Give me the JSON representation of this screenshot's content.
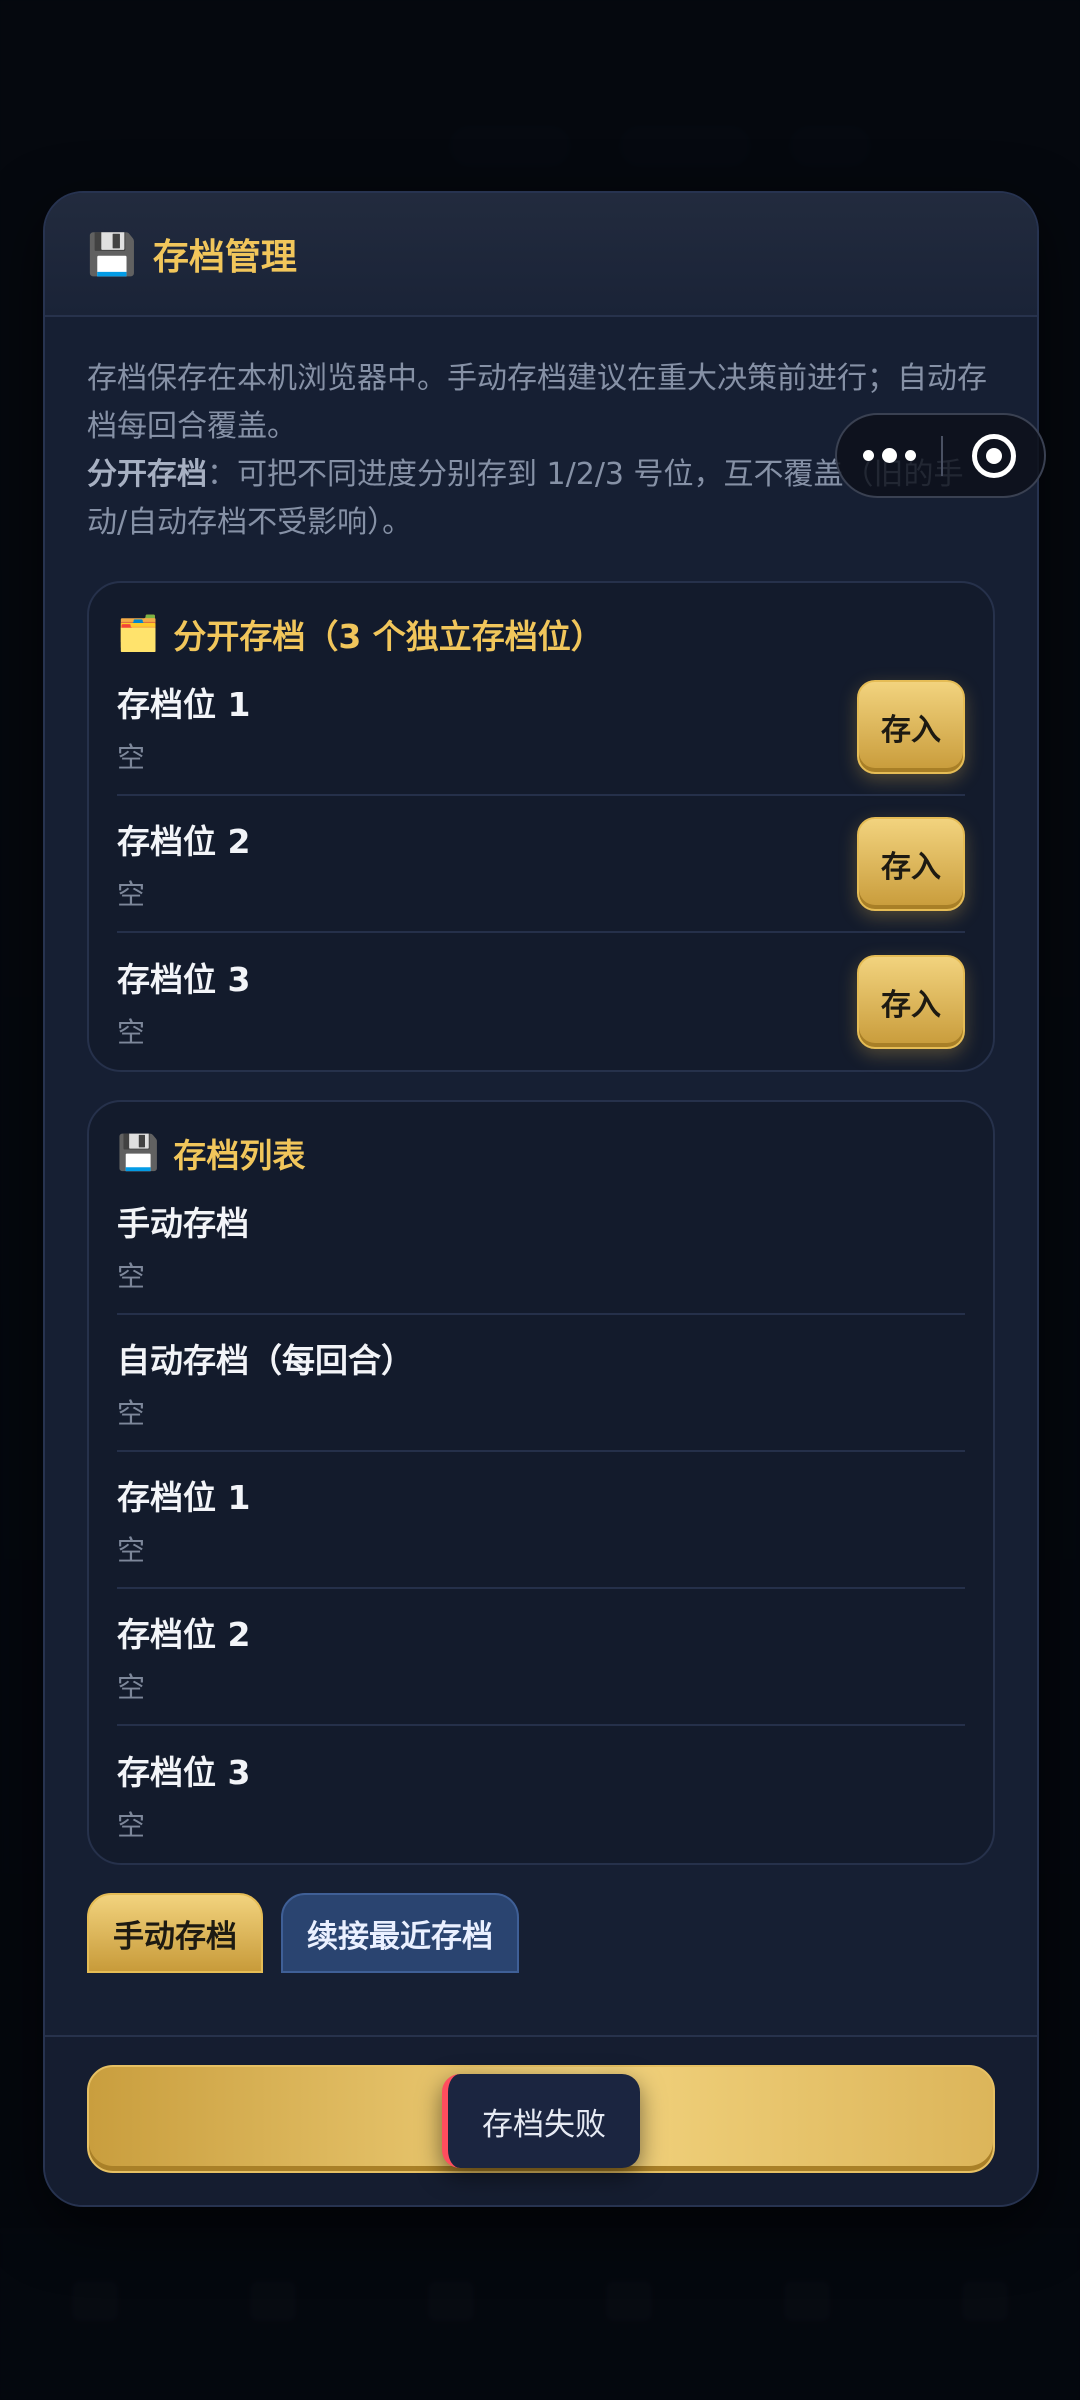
{
  "modal": {
    "icon": "floppy-disk-icon",
    "title": "存档管理",
    "desc_line1": "存档保存在本机浏览器中。手动存档建议在重大决策前进行；自动存档每回合覆盖。",
    "desc_bold": "分开存档",
    "desc_line2": "：可把不同进度分别存到 1/2/3 号位，互不覆盖（旧的手动/自动存档不受影响）。"
  },
  "slots_card": {
    "icon": "folder-icon",
    "title": "分开存档（3 个独立存档位）",
    "slots": [
      {
        "name": "存档位 1",
        "value": "空",
        "button": "存入"
      },
      {
        "name": "存档位 2",
        "value": "空",
        "button": "存入"
      },
      {
        "name": "存档位 3",
        "value": "空",
        "button": "存入"
      }
    ]
  },
  "list_card": {
    "icon": "floppy-disk-icon",
    "title": "存档列表",
    "items": [
      {
        "name": "手动存档",
        "value": "空"
      },
      {
        "name": "自动存档（每回合）",
        "value": "空"
      },
      {
        "name": "存档位 1",
        "value": "空"
      },
      {
        "name": "存档位 2",
        "value": "空"
      },
      {
        "name": "存档位 3",
        "value": "空"
      }
    ]
  },
  "actions": {
    "manual_save": "手动存档",
    "resume": "续接最近存档"
  },
  "toast": {
    "message": "存档失败",
    "accent": "#ff4d5e"
  },
  "colors": {
    "accent_gold": "#f1c65b",
    "panel": "#161f33"
  }
}
